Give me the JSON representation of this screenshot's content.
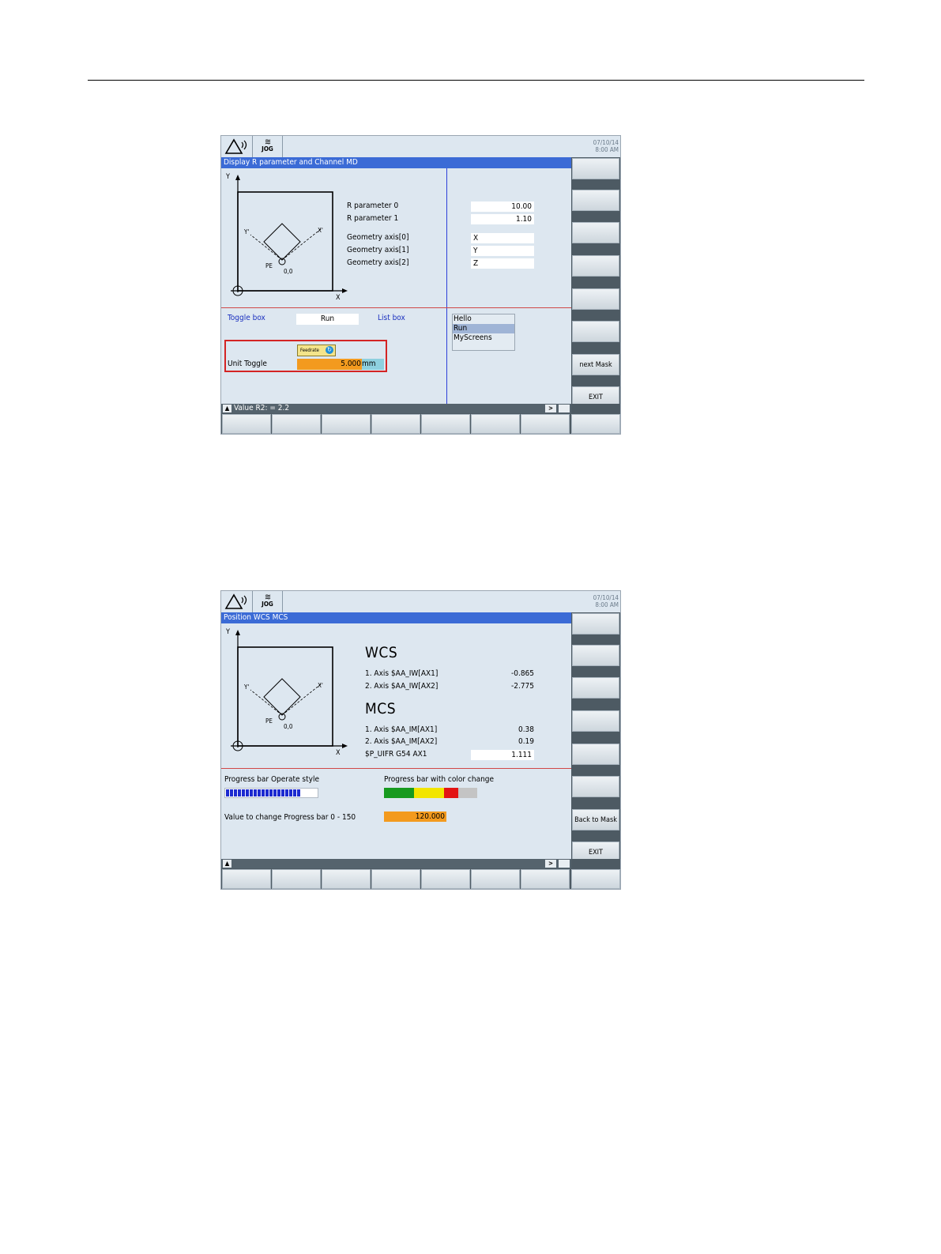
{
  "screen1": {
    "topbar": {
      "mode": "JOG",
      "date": "07/10/14",
      "time": "8:00 AM"
    },
    "title": "Display R parameter and Channel MD",
    "diagram": {
      "y_label": "Y",
      "x_label": "X",
      "x_prime": "X'",
      "y_prime": "Y'",
      "pe": "PE",
      "origin": "0,0"
    },
    "params": [
      {
        "label": "R parameter 0",
        "value": "10.00"
      },
      {
        "label": "R parameter 1",
        "value": "1.10"
      }
    ],
    "geometry": [
      {
        "label": "Geometry axis[0]",
        "value": "X"
      },
      {
        "label": "Geometry axis[1]",
        "value": "Y"
      },
      {
        "label": "Geometry axis[2]",
        "value": "Z"
      }
    ],
    "toggle_box": {
      "label": "Toggle box",
      "value": "Run"
    },
    "list_box": {
      "label": "List box",
      "items": [
        "Hello",
        "Run",
        "MyScreens"
      ],
      "selected": "Run"
    },
    "feedrate_label": "Feedrate",
    "unit_toggle": {
      "label": "Unit Toggle",
      "value": "5.000",
      "unit": "mm"
    },
    "status_message": "Value R2: = 2.2",
    "softkeys_right": [
      "",
      "",
      "",
      "",
      "",
      "",
      "next Mask",
      "EXIT"
    ]
  },
  "screen2": {
    "topbar": {
      "mode": "JOG",
      "date": "07/10/14",
      "time": "8:00 AM"
    },
    "title": "Position WCS MCS",
    "diagram": {
      "y_label": "Y",
      "x_label": "X",
      "x_prime": "X'",
      "y_prime": "Y'",
      "pe": "PE",
      "origin": "0,0"
    },
    "wcs": {
      "heading": "WCS",
      "rows": [
        {
          "label": "1. Axis $AA_IW[AX1]",
          "value": "-0.865"
        },
        {
          "label": "2. Axis $AA_IW[AX2]",
          "value": "-2.775"
        }
      ]
    },
    "mcs": {
      "heading": "MCS",
      "rows": [
        {
          "label": "1. Axis $AA_IM[AX1]",
          "value": "0.38"
        },
        {
          "label": "2. Axis $AA_IM[AX2]",
          "value": "0.19"
        }
      ]
    },
    "uifr": {
      "label": "$P_UIFR G54 AX1",
      "value": "1.111"
    },
    "progress_operate": {
      "label": "Progress bar Operate style",
      "fraction": 0.8
    },
    "progress_color": {
      "label": "Progress bar with color change",
      "fraction": 0.8
    },
    "value_change": {
      "label": "Value to change Progress bar 0 - 150",
      "value": "120.000"
    },
    "colors": {
      "green": "#179a1f",
      "yellow": "#f2e500",
      "red": "#e31414",
      "grey": "#c4c4c4",
      "blue": "#1c2ad0",
      "orange": "#f39a1e",
      "titlebar": "#3b6bd6"
    },
    "softkeys_right": [
      "",
      "",
      "",
      "",
      "",
      "",
      "Back to Mask",
      "EXIT"
    ]
  }
}
